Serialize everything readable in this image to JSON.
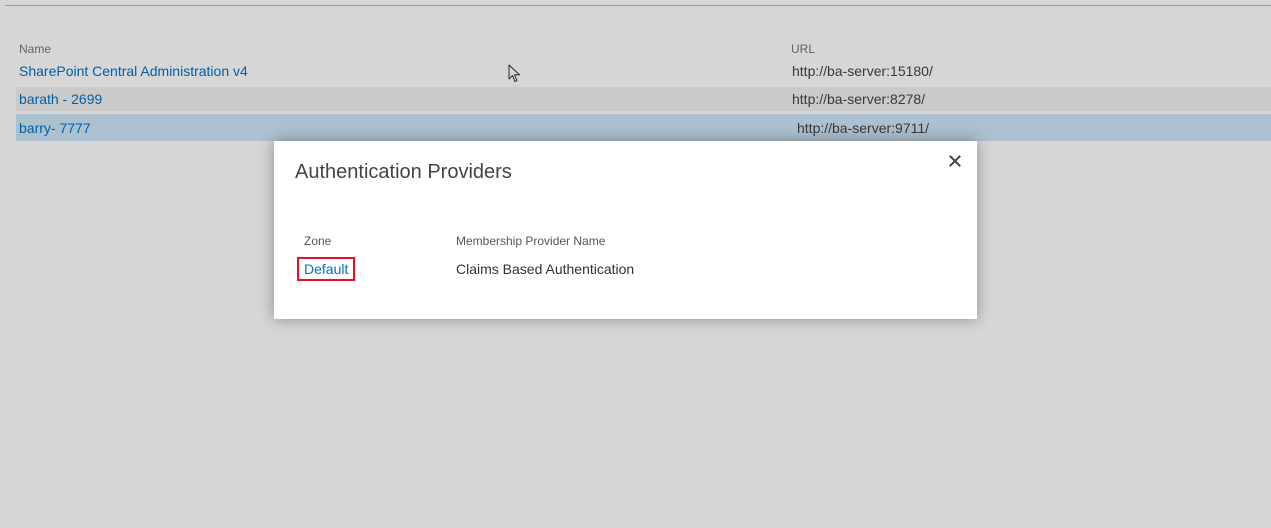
{
  "webapp_list": {
    "columns": {
      "name": "Name",
      "url": "URL"
    },
    "rows": [
      {
        "name": "SharePoint Central Administration v4",
        "url": "http://ba-server:15180/"
      },
      {
        "name": "barath - 2699",
        "url": "http://ba-server:8278/"
      },
      {
        "name": "barry- 7777",
        "url": "http://ba-server:9711/"
      }
    ],
    "selected_row": 2
  },
  "dialog": {
    "title": "Authentication Providers",
    "close_icon": "close-icon",
    "columns": {
      "zone": "Zone",
      "provider": "Membership Provider Name"
    },
    "zones": [
      {
        "zone": "Default",
        "provider": "Claims Based Authentication"
      }
    ],
    "highlight_color": "#e81123"
  },
  "colors": {
    "link": "#0072c6",
    "selected_row": "#cde6f7",
    "alt_row": "#f1f1f1"
  },
  "cursor_icon": "mouse-pointer-icon"
}
